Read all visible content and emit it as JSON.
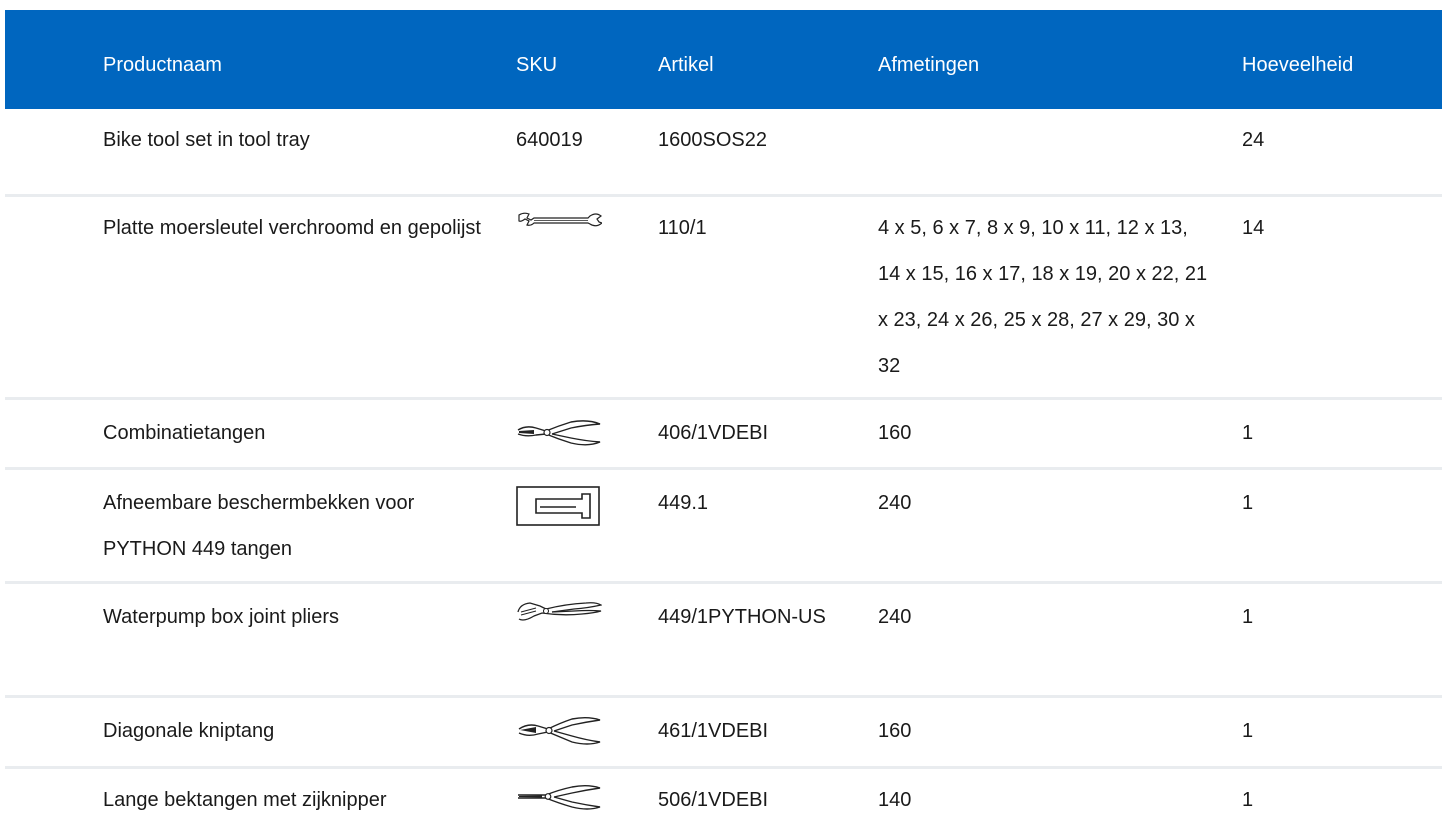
{
  "table": {
    "headers": {
      "name": "Productnaam",
      "sku": "SKU",
      "article": "Artikel",
      "dimensions": "Afmetingen",
      "quantity": "Hoeveelheid"
    },
    "header_color": "#0066bf",
    "rows": [
      {
        "name": "Bike tool set in tool tray",
        "sku": "640019",
        "icon": null,
        "article": "1600SOS22",
        "dimensions": "",
        "quantity": "24"
      },
      {
        "name": "Platte moersleutel verchroomd en gepolijst",
        "sku": "",
        "icon": "open-end-wrench-icon",
        "article": "110/1",
        "dimensions": "4 x 5, 6 x 7, 8 x 9, 10 x 11, 12 x 13, 14 x 15, 16 x 17, 18 x 19, 20 x 22, 21 x 23, 24 x 26, 25 x 28, 27 x 29, 30 x 32",
        "quantity": "14"
      },
      {
        "name": "Combinatietangen",
        "sku": "",
        "icon": "combination-pliers-icon",
        "article": "406/1VDEBI",
        "dimensions": "160",
        "quantity": "1"
      },
      {
        "name": "Afneembare beschermbekken voor PYTHON 449 tangen",
        "sku": "",
        "icon": "protective-jaws-icon",
        "article": "449.1",
        "dimensions": "240",
        "quantity": "1"
      },
      {
        "name": "Waterpump box joint pliers",
        "sku": "",
        "icon": "waterpump-pliers-icon",
        "article": "449/1PYTHON-US",
        "dimensions": "240",
        "quantity": "1"
      },
      {
        "name": "Diagonale kniptang",
        "sku": "",
        "icon": "diagonal-cutter-icon",
        "article": "461/1VDEBI",
        "dimensions": "160",
        "quantity": "1"
      },
      {
        "name": "Lange bektangen met zijknipper",
        "sku": "",
        "icon": "long-nose-pliers-icon",
        "article": "506/1VDEBI",
        "dimensions": "140",
        "quantity": "1"
      }
    ]
  }
}
